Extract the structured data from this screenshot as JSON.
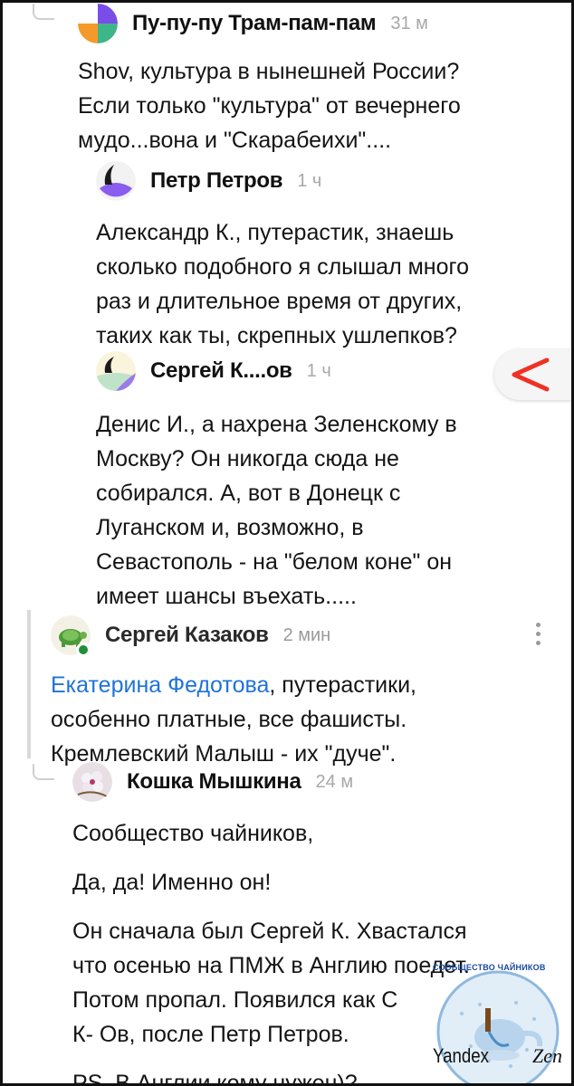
{
  "comments": [
    {
      "author": "Пу-пу-пу Трам-пам-пам",
      "time": "31 м",
      "lines": [
        "Shov, культура в нынешней России?",
        "Если только \"культура\" от вечернего",
        "мудо...вона и \"Скарабеихи\"...."
      ]
    },
    {
      "author": "Петр Петров",
      "time": "1 ч",
      "lines": [
        "Александр К., путерастик, знаешь",
        "сколько подобного я слышал много",
        "раз и длительное время от других,",
        "таких как ты, скрепных ушлепков?"
      ]
    },
    {
      "author": "Сергей К....ов",
      "time": "1 ч",
      "lines": [
        "Денис И., а нахрена Зеленскому в",
        "Москву? Он никогда сюда не",
        "собирался. А, вот в Донецк с",
        "Луганском и, возможно, в",
        "Севастополь - на \"белом коне\" он",
        "имеет шансы въехать....."
      ]
    },
    {
      "author": "Сергей Казаков",
      "time": "2 мин",
      "mention": "Екатерина Федотова",
      "first_line_rest": ", путерастики,",
      "lines": [
        "особенно платные, все фашисты.",
        "Кремлевский Малыш - их \"дуче\"."
      ]
    },
    {
      "author": "Кошка Мышкина",
      "time": "24 м",
      "paragraphs": [
        [
          "Сообщество чайников,"
        ],
        [
          "Да, да! Именно он!"
        ],
        [
          "Он сначала был Сергей К. Хвастался",
          "что осенью на ПМЖ в Англию поедет.",
          "Потом пропал. Появился как С",
          "К- Ов, после Петр Петров."
        ],
        [
          "PS. В Англии кому нужен)?"
        ]
      ]
    }
  ],
  "watermark": {
    "community": "СООБЩЕСТВО ЧАЙНИКОВ",
    "brand_left": "Yandex",
    "brand_right": "Zen"
  },
  "colors": {
    "mention": "#1e73d9",
    "timestamp": "#a8a8a8",
    "online": "#1f8f3a",
    "share_accent": "#ef3124"
  }
}
